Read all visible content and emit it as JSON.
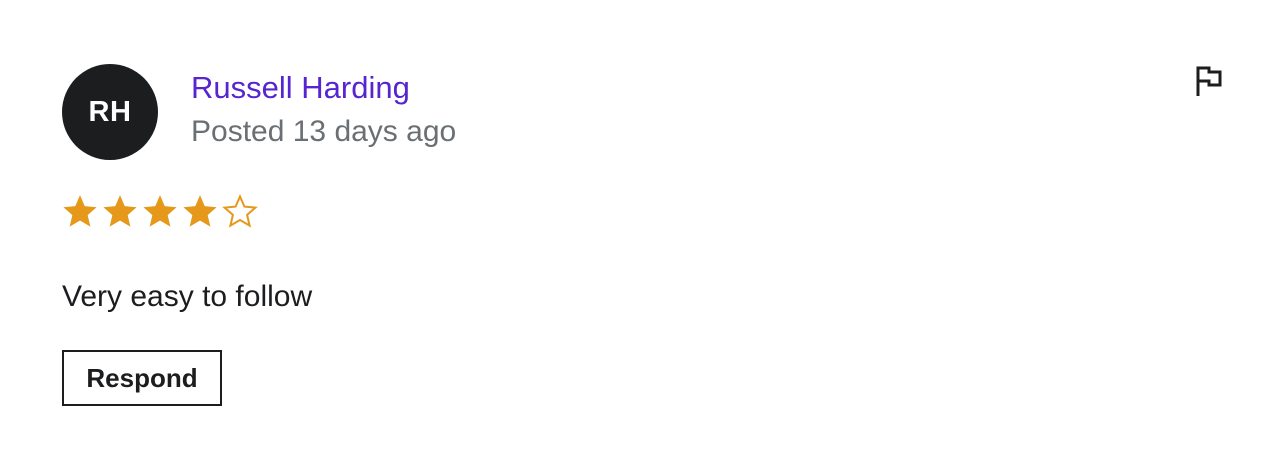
{
  "review": {
    "avatar_initials": "RH",
    "reviewer_name": "Russell Harding",
    "posted_date": "Posted 13 days ago",
    "rating": 4,
    "max_rating": 5,
    "text": "Very easy to follow",
    "respond_label": "Respond",
    "flag_icon": "flag-icon"
  },
  "colors": {
    "accent": "#5624d0",
    "star": "#e59819",
    "text": "#1c1d1f",
    "muted": "#6a6f73",
    "avatar_bg": "#1c1d1f"
  }
}
